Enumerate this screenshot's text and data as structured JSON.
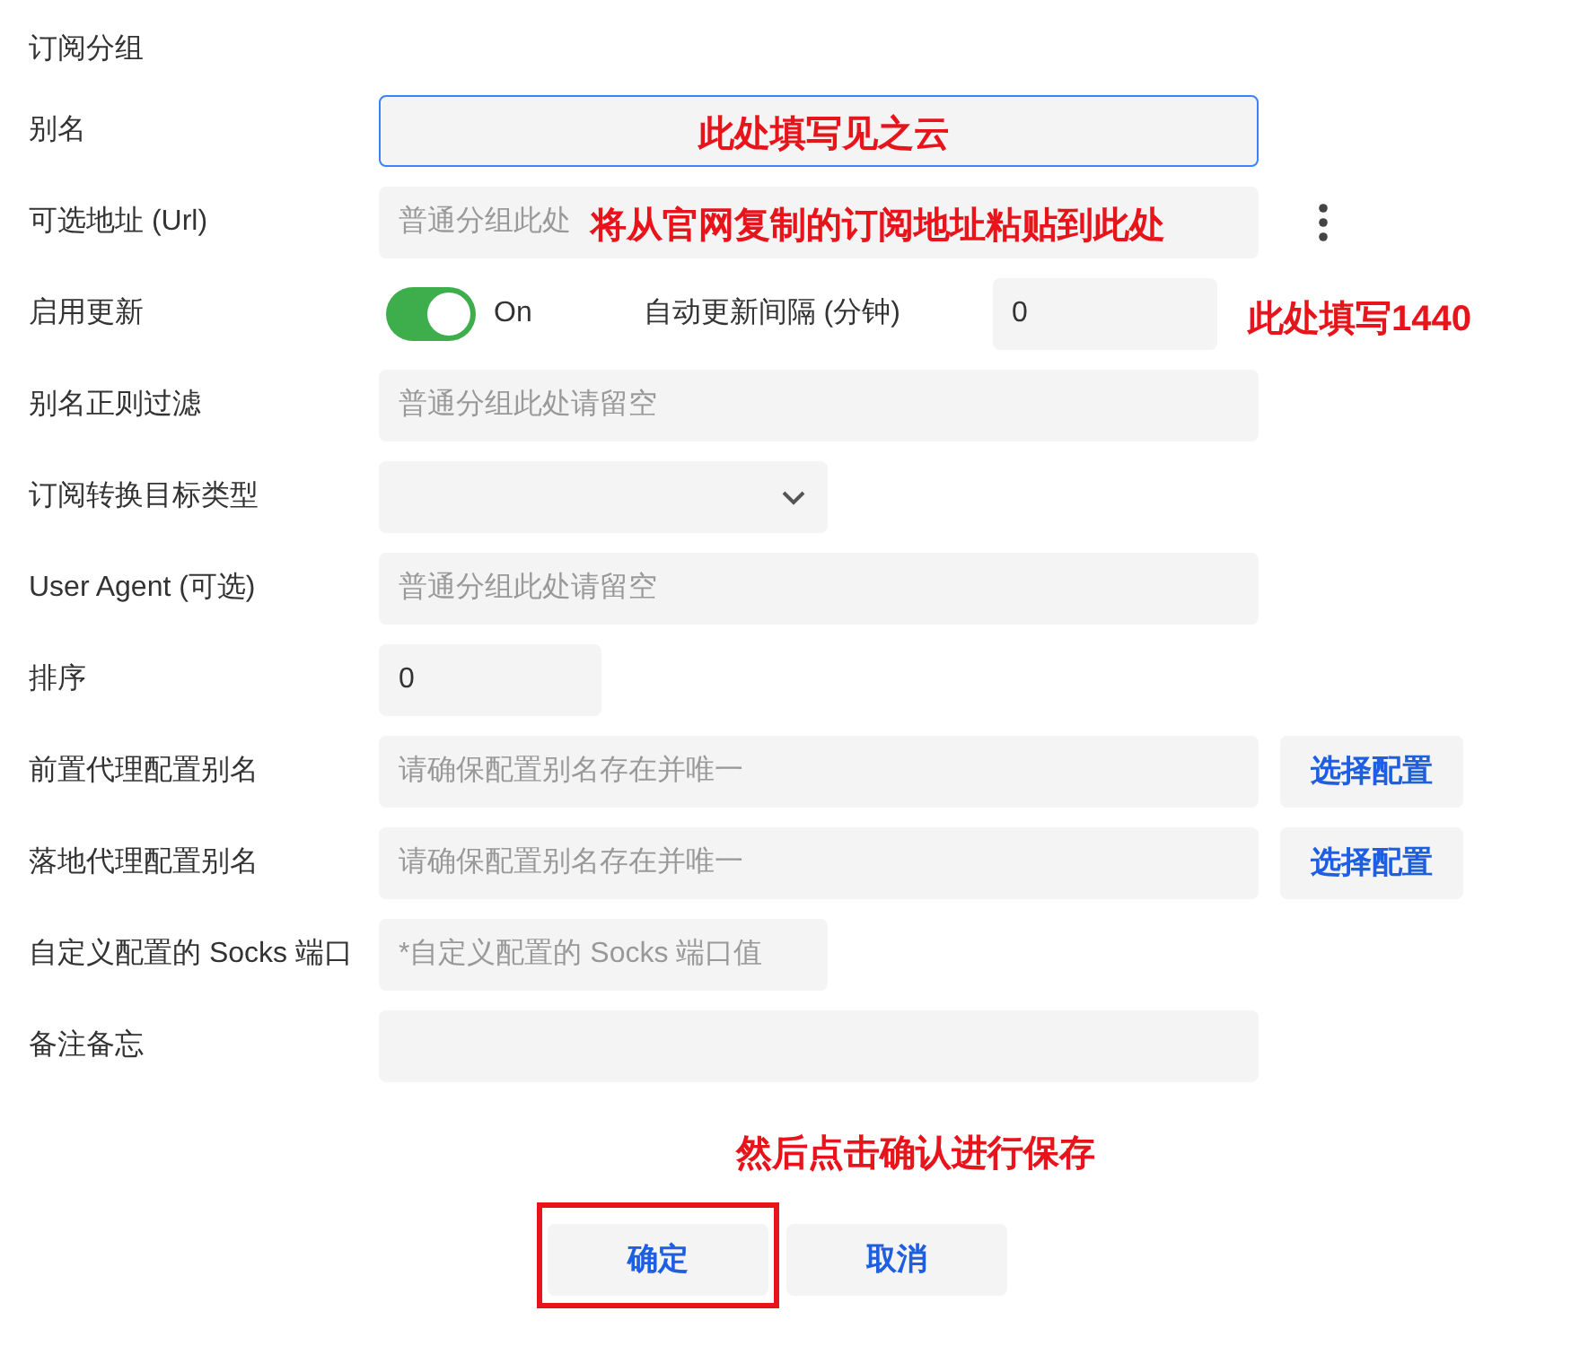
{
  "section_title": "订阅分组",
  "rows": [
    {
      "kind": "input",
      "label": "别名",
      "value": "",
      "focused": true,
      "annotation": "此处填写见之云"
    },
    {
      "kind": "input_menu",
      "label": "可选地址 (Url)",
      "placeholder": "普通分组此处",
      "focused": false,
      "annotation": "将从官网复制的订阅地址粘贴到此处"
    },
    {
      "kind": "toggle",
      "label": "启用更新",
      "on": true,
      "state_text": "On",
      "interval_label": "自动更新间隔 (分钟)",
      "interval_value": "0",
      "annotation": "此处填写1440"
    },
    {
      "kind": "input",
      "label": "别名正则过滤",
      "placeholder": "普通分组此处请留空",
      "focused": false
    },
    {
      "kind": "select",
      "label": "订阅转换目标类型"
    },
    {
      "kind": "input",
      "label": "User Agent (可选)",
      "placeholder": "普通分组此处请留空",
      "focused": false
    },
    {
      "kind": "input_small",
      "label": "排序",
      "value": "0",
      "focused": false
    },
    {
      "kind": "input_button",
      "label": "前置代理配置别名",
      "placeholder": "请确保配置别名存在并唯一",
      "button": "选择配置",
      "focused": false
    },
    {
      "kind": "input_button",
      "label": "落地代理配置别名",
      "placeholder": "请确保配置别名存在并唯一",
      "button": "选择配置",
      "focused": false
    },
    {
      "kind": "input_medium",
      "label": "自定义配置的 Socks 端口",
      "placeholder": "*自定义配置的 Socks 端口值",
      "focused": false
    },
    {
      "kind": "input",
      "label": "备注备忘",
      "focused": false
    }
  ],
  "footer_annotation": "然后点击确认进行保存",
  "buttons": [
    {
      "label": "确定",
      "highlighted": true
    },
    {
      "label": "取消",
      "highlighted": false
    }
  ]
}
